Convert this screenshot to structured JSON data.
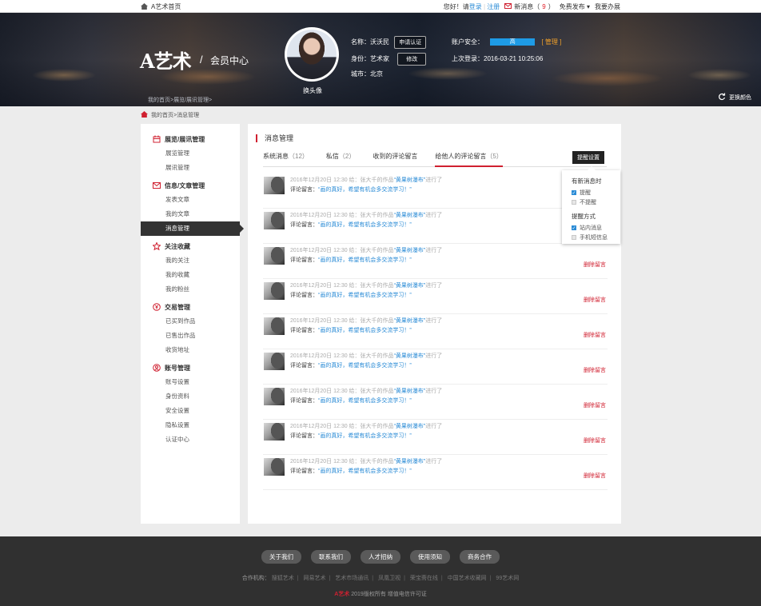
{
  "topbar": {
    "home_label": "A艺术首页",
    "greeting": "您好！请",
    "login": "登录",
    "sep": "|",
    "register": "注册",
    "new_msg_label": "新消息（",
    "new_msg_count": "9",
    "new_msg_close": "）",
    "publish": "免费发布",
    "ticket": "我要办展"
  },
  "banner": {
    "logo": "A艺术",
    "slash": "/",
    "section_title": "会员中心",
    "breadcrumb": "我的首页>展览/展讯管理>",
    "change_avatar": "换头像",
    "name_label": "名称：沃沃民",
    "apply_cert": "申请认证",
    "identity_label": "身份：艺术家",
    "modify": "修改",
    "city_label": "城市：北京",
    "security_label": "账户安全：",
    "security_level": "高",
    "manage": "[ 管理 ]",
    "last_login": "上次登录：2016-03-21  10:25:06",
    "swap_color": "更换颜色"
  },
  "breadcrumb": "我的首页>消息管理",
  "sidebar": {
    "groups": [
      {
        "title": "展览/展讯管理",
        "items": [
          "展览管理",
          "展讯管理"
        ]
      },
      {
        "title": "信息/文章管理",
        "items": [
          "发表文章",
          "我的文章",
          "消息管理"
        ]
      },
      {
        "title": "关注收藏",
        "items": [
          "我的关注",
          "我的收藏",
          "我的粉丝"
        ]
      },
      {
        "title": "交易管理",
        "items": [
          "已买到作品",
          "已售出作品",
          "收货地址"
        ]
      },
      {
        "title": "账号管理",
        "items": [
          "账号设置",
          "身份资料",
          "安全设置",
          "隐私设置",
          "认证中心"
        ]
      }
    ]
  },
  "main": {
    "title": "消息管理",
    "tabs": [
      {
        "label": "系统消息",
        "count": "（12）"
      },
      {
        "label": "私信",
        "count": "（2）"
      },
      {
        "label": "收到的评论留言",
        "count": ""
      },
      {
        "label": "给他人的评论留言",
        "count": "（5）"
      }
    ],
    "remind_button": "提醒设置",
    "message": {
      "meta_prefix": "2016年12月20日 12:30 给：张大千的作品",
      "work": "“黄果树瀑布”",
      "meta_suffix": "进行了",
      "comment_label": "评论留言：",
      "comment": "“画的真好，希望有机会多交流学习！”",
      "delete": "删除留言"
    },
    "message_count": 9
  },
  "popup": {
    "heading1": "有新消息时",
    "opt_remind": "提醒",
    "opt_no_remind": "不提醒",
    "heading2": "提醒方式",
    "opt_site": "站内消息",
    "opt_sms": "手机短信息"
  },
  "footer": {
    "buttons": [
      "关于我们",
      "联系我们",
      "人才招纳",
      "使用须知",
      "商务合作"
    ],
    "partners_label": "合作机构：",
    "partners": [
      "搜狐艺术",
      "网易艺术",
      "艺术市场通讯",
      "凤凰卫视",
      "荣宝斋在线",
      "中国艺术收藏网",
      "99艺术网"
    ],
    "copy_brand": "A艺术",
    "copy_rest": " 2019版权所有    增值电信许可证"
  },
  "colors": {
    "accent": "#d02030",
    "link": "#2a8bd6",
    "security_bar": "#1e9be6"
  }
}
